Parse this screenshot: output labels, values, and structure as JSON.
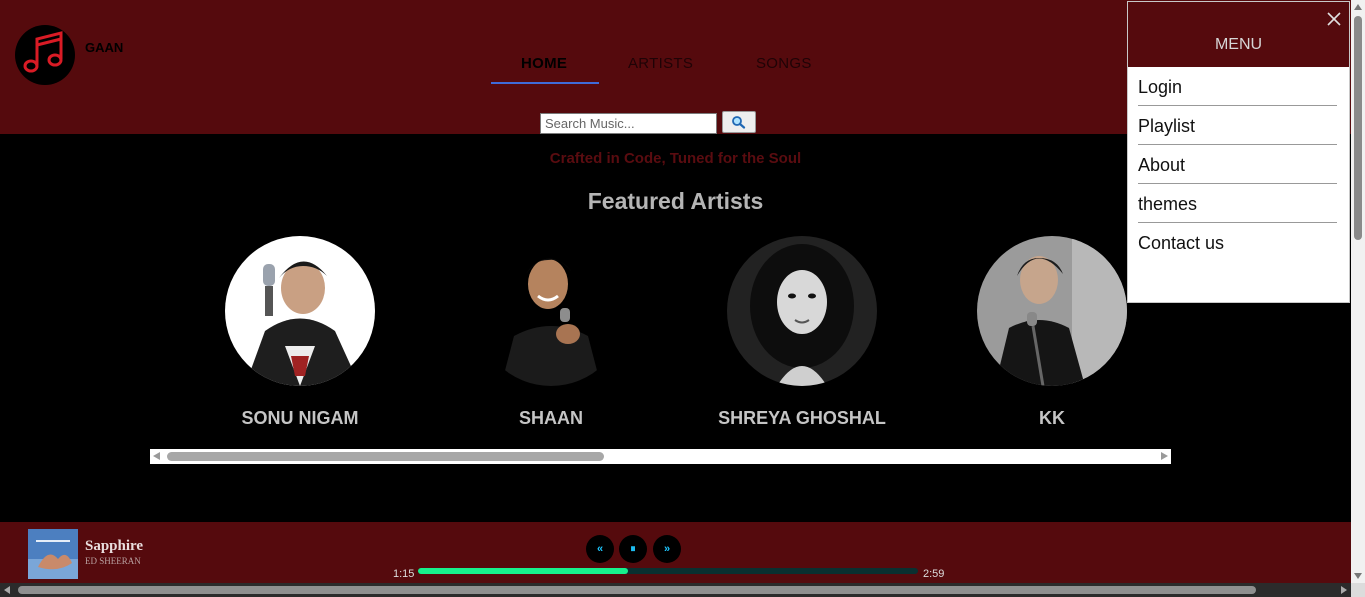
{
  "header": {
    "brand": "GAAN",
    "nav": [
      {
        "label": "HOME",
        "active": true
      },
      {
        "label": "ARTISTS"
      },
      {
        "label": "SONGS"
      }
    ],
    "search": {
      "placeholder": "Search Music...",
      "value": ""
    }
  },
  "main": {
    "tagline": "Crafted in Code, Tuned for the Soul",
    "section_title": "Featured Artists",
    "artists": [
      {
        "name": "SONU NIGAM"
      },
      {
        "name": "SHAAN"
      },
      {
        "name": "SHREYA GHOSHAL"
      },
      {
        "name": "KK"
      }
    ]
  },
  "menu": {
    "title": "MENU",
    "items": [
      "Login",
      "Playlist",
      "About",
      "themes",
      "Contact us"
    ]
  },
  "player": {
    "song_title": "Sapphire",
    "song_artist": "ED SHEERAN",
    "current_time": "1:15",
    "duration": "2:59",
    "progress_fraction": 0.42,
    "controls": {
      "prev": "«",
      "pause": "⏸",
      "next": "»"
    }
  },
  "colors": {
    "header_bg": "#550a0d",
    "progress": "#17f08c",
    "control_icon": "#1ec8ff",
    "nav_underline": "#3f6bd8"
  }
}
